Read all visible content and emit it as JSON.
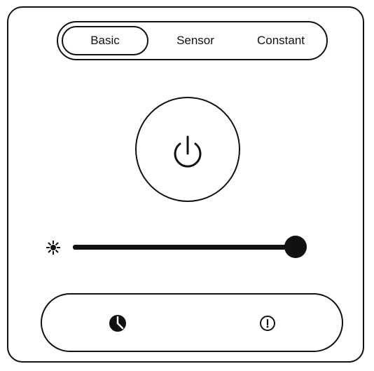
{
  "mode_tabs": {
    "items": [
      "Basic",
      "Sensor",
      "Constant"
    ],
    "selected": "Basic"
  },
  "power": {
    "icon": "power-icon"
  },
  "brightness": {
    "icon": "brightness-icon",
    "level_percent": 100
  },
  "bottom_bar": {
    "left_icon": "clock-icon",
    "right_icon": "timer-icon"
  }
}
